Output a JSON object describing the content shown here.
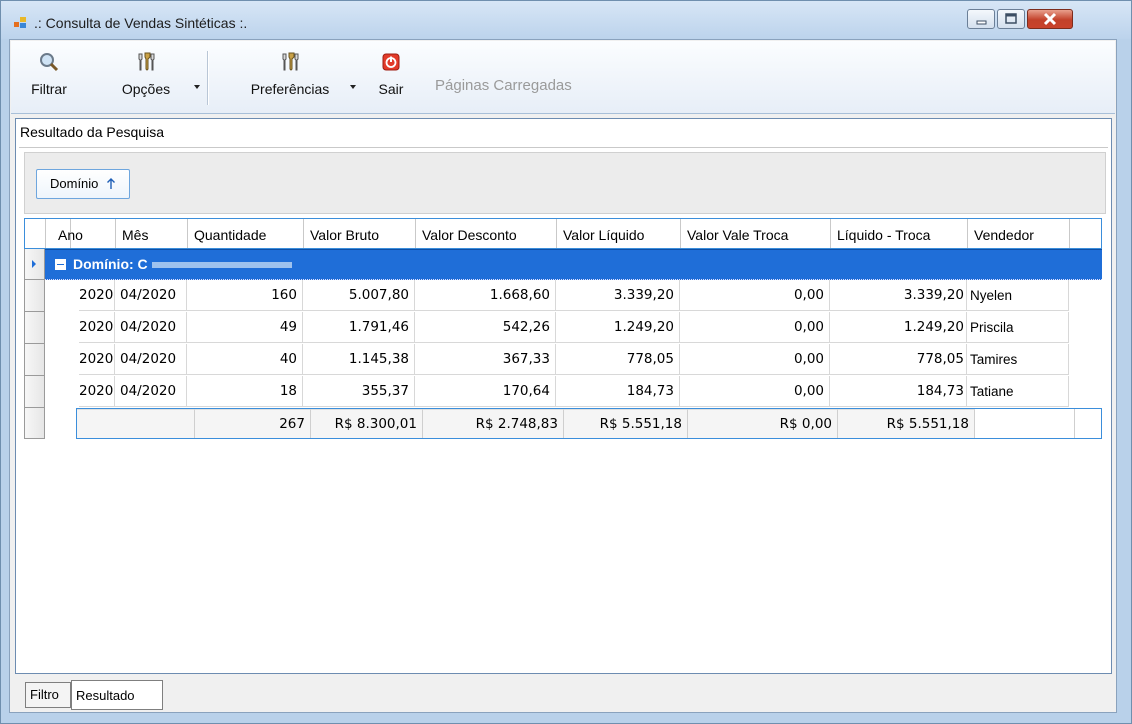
{
  "window": {
    "title": ".: Consulta de Vendas Sintéticas :."
  },
  "toolbar": {
    "filter_label": "Filtrar",
    "options_label": "Opções",
    "preferences_label": "Preferências",
    "exit_label": "Sair",
    "pages_loaded_label": "Páginas Carregadas"
  },
  "panel": {
    "title": "Resultado da Pesquisa"
  },
  "grouping": {
    "chip_label": "Domínio",
    "sort_icon": "up-arrow-icon"
  },
  "grid": {
    "columns": [
      "Ano",
      "Mês",
      "Quantidade",
      "Valor Bruto",
      "Valor Desconto",
      "Valor Líquido",
      "Valor Vale Troca",
      "Líquido - Troca",
      "Vendedor"
    ],
    "group_label": "Domínio: C",
    "rows": [
      [
        "2020",
        "04/2020",
        "160",
        "5.007,80",
        "1.668,60",
        "3.339,20",
        "0,00",
        "3.339,20",
        "Nyelen"
      ],
      [
        "2020",
        "04/2020",
        "49",
        "1.791,46",
        "542,26",
        "1.249,20",
        "0,00",
        "1.249,20",
        "Priscila"
      ],
      [
        "2020",
        "04/2020",
        "40",
        "1.145,38",
        "367,33",
        "778,05",
        "0,00",
        "778,05",
        "Tamires"
      ],
      [
        "2020",
        "04/2020",
        "18",
        "355,37",
        "170,64",
        "184,73",
        "0,00",
        "184,73",
        "Tatiane"
      ]
    ],
    "summary": [
      "267",
      "R$ 8.300,01",
      "R$ 2.748,83",
      "R$ 5.551,18",
      "R$ 0,00",
      "R$ 5.551,18"
    ]
  },
  "tabs": [
    "Filtro",
    "Resultado"
  ],
  "colors": {
    "accent": "#1f6ed8",
    "window_border": "#6f8fae",
    "close_red": "#c2412a"
  }
}
